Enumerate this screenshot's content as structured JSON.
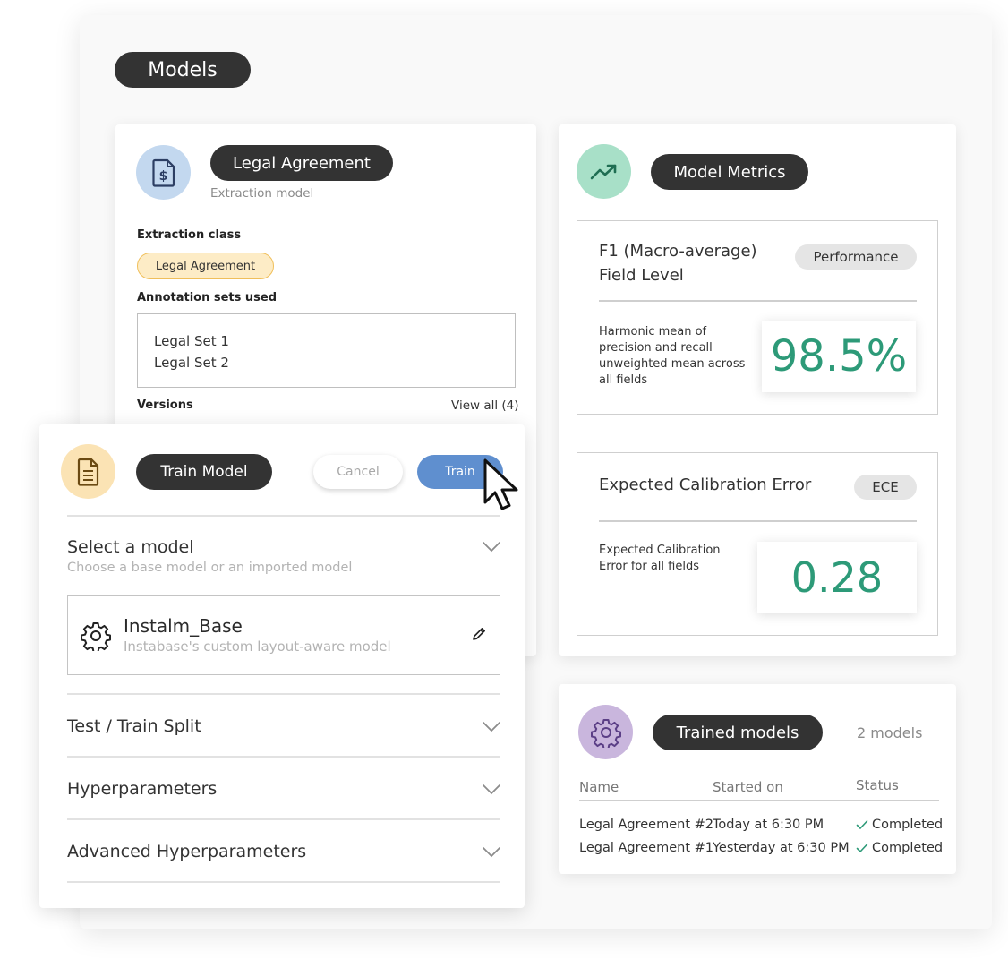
{
  "page": {
    "title": "Models"
  },
  "legal_card": {
    "title": "Legal Agreement",
    "subtitle": "Extraction model",
    "extraction_class_label": "Extraction class",
    "extraction_class_value": "Legal Agreement",
    "annotation_label": "Annotation sets used",
    "annotation_sets": [
      "Legal Set 1",
      "Legal Set 2"
    ],
    "versions_label": "Versions",
    "view_all": "View all (4)"
  },
  "train_card": {
    "title": "Train Model",
    "cancel_label": "Cancel",
    "train_label": "Train",
    "select_model_title": "Select a model",
    "select_model_hint": "Choose a base model or an imported model",
    "model_name": "Instalm_Base",
    "model_desc": "Instabase's custom layout-aware model",
    "sections": [
      "Test / Train Split",
      "Hyperparameters",
      "Advanced Hyperparameters"
    ]
  },
  "metrics_card": {
    "title": "Model Metrics",
    "f1": {
      "title_line1": "F1 (Macro-average)",
      "title_line2": "Field Level",
      "tag": "Performance",
      "desc": "Harmonic mean of precision and recall unweighted mean across all fields",
      "value": "98.5%"
    },
    "ece": {
      "title": "Expected Calibration Error",
      "tag": "ECE",
      "desc": "Expected Calibration Error for all fields",
      "value": "0.28"
    }
  },
  "trained_card": {
    "title": "Trained models",
    "count": "2 models",
    "columns": [
      "Name",
      "Started on",
      "Status"
    ],
    "rows": [
      {
        "name": "Legal Agreement #2",
        "started": "Today at 6:30 PM",
        "status": "Completed"
      },
      {
        "name": "Legal Agreement #1",
        "started": "Yesterday at 6:30 PM",
        "status": "Completed"
      }
    ]
  },
  "colors": {
    "accent_blue": "#5f8fcf",
    "metric_green": "#2d9a78",
    "pill_dark": "#333333",
    "icon_blue_bg": "#c3d8ef",
    "icon_yellow_bg": "#fbe3b4",
    "icon_green_bg": "#a8e0c8",
    "icon_purple_bg": "#c9b6dd"
  },
  "icons": {
    "legal": "document-dollar-icon",
    "train": "document-icon",
    "metrics": "trend-up-icon",
    "trained": "gear-icon",
    "model": "model-gear-icon",
    "edit": "pencil-icon",
    "status": "check-icon",
    "cursor": "mouse-cursor-icon"
  }
}
